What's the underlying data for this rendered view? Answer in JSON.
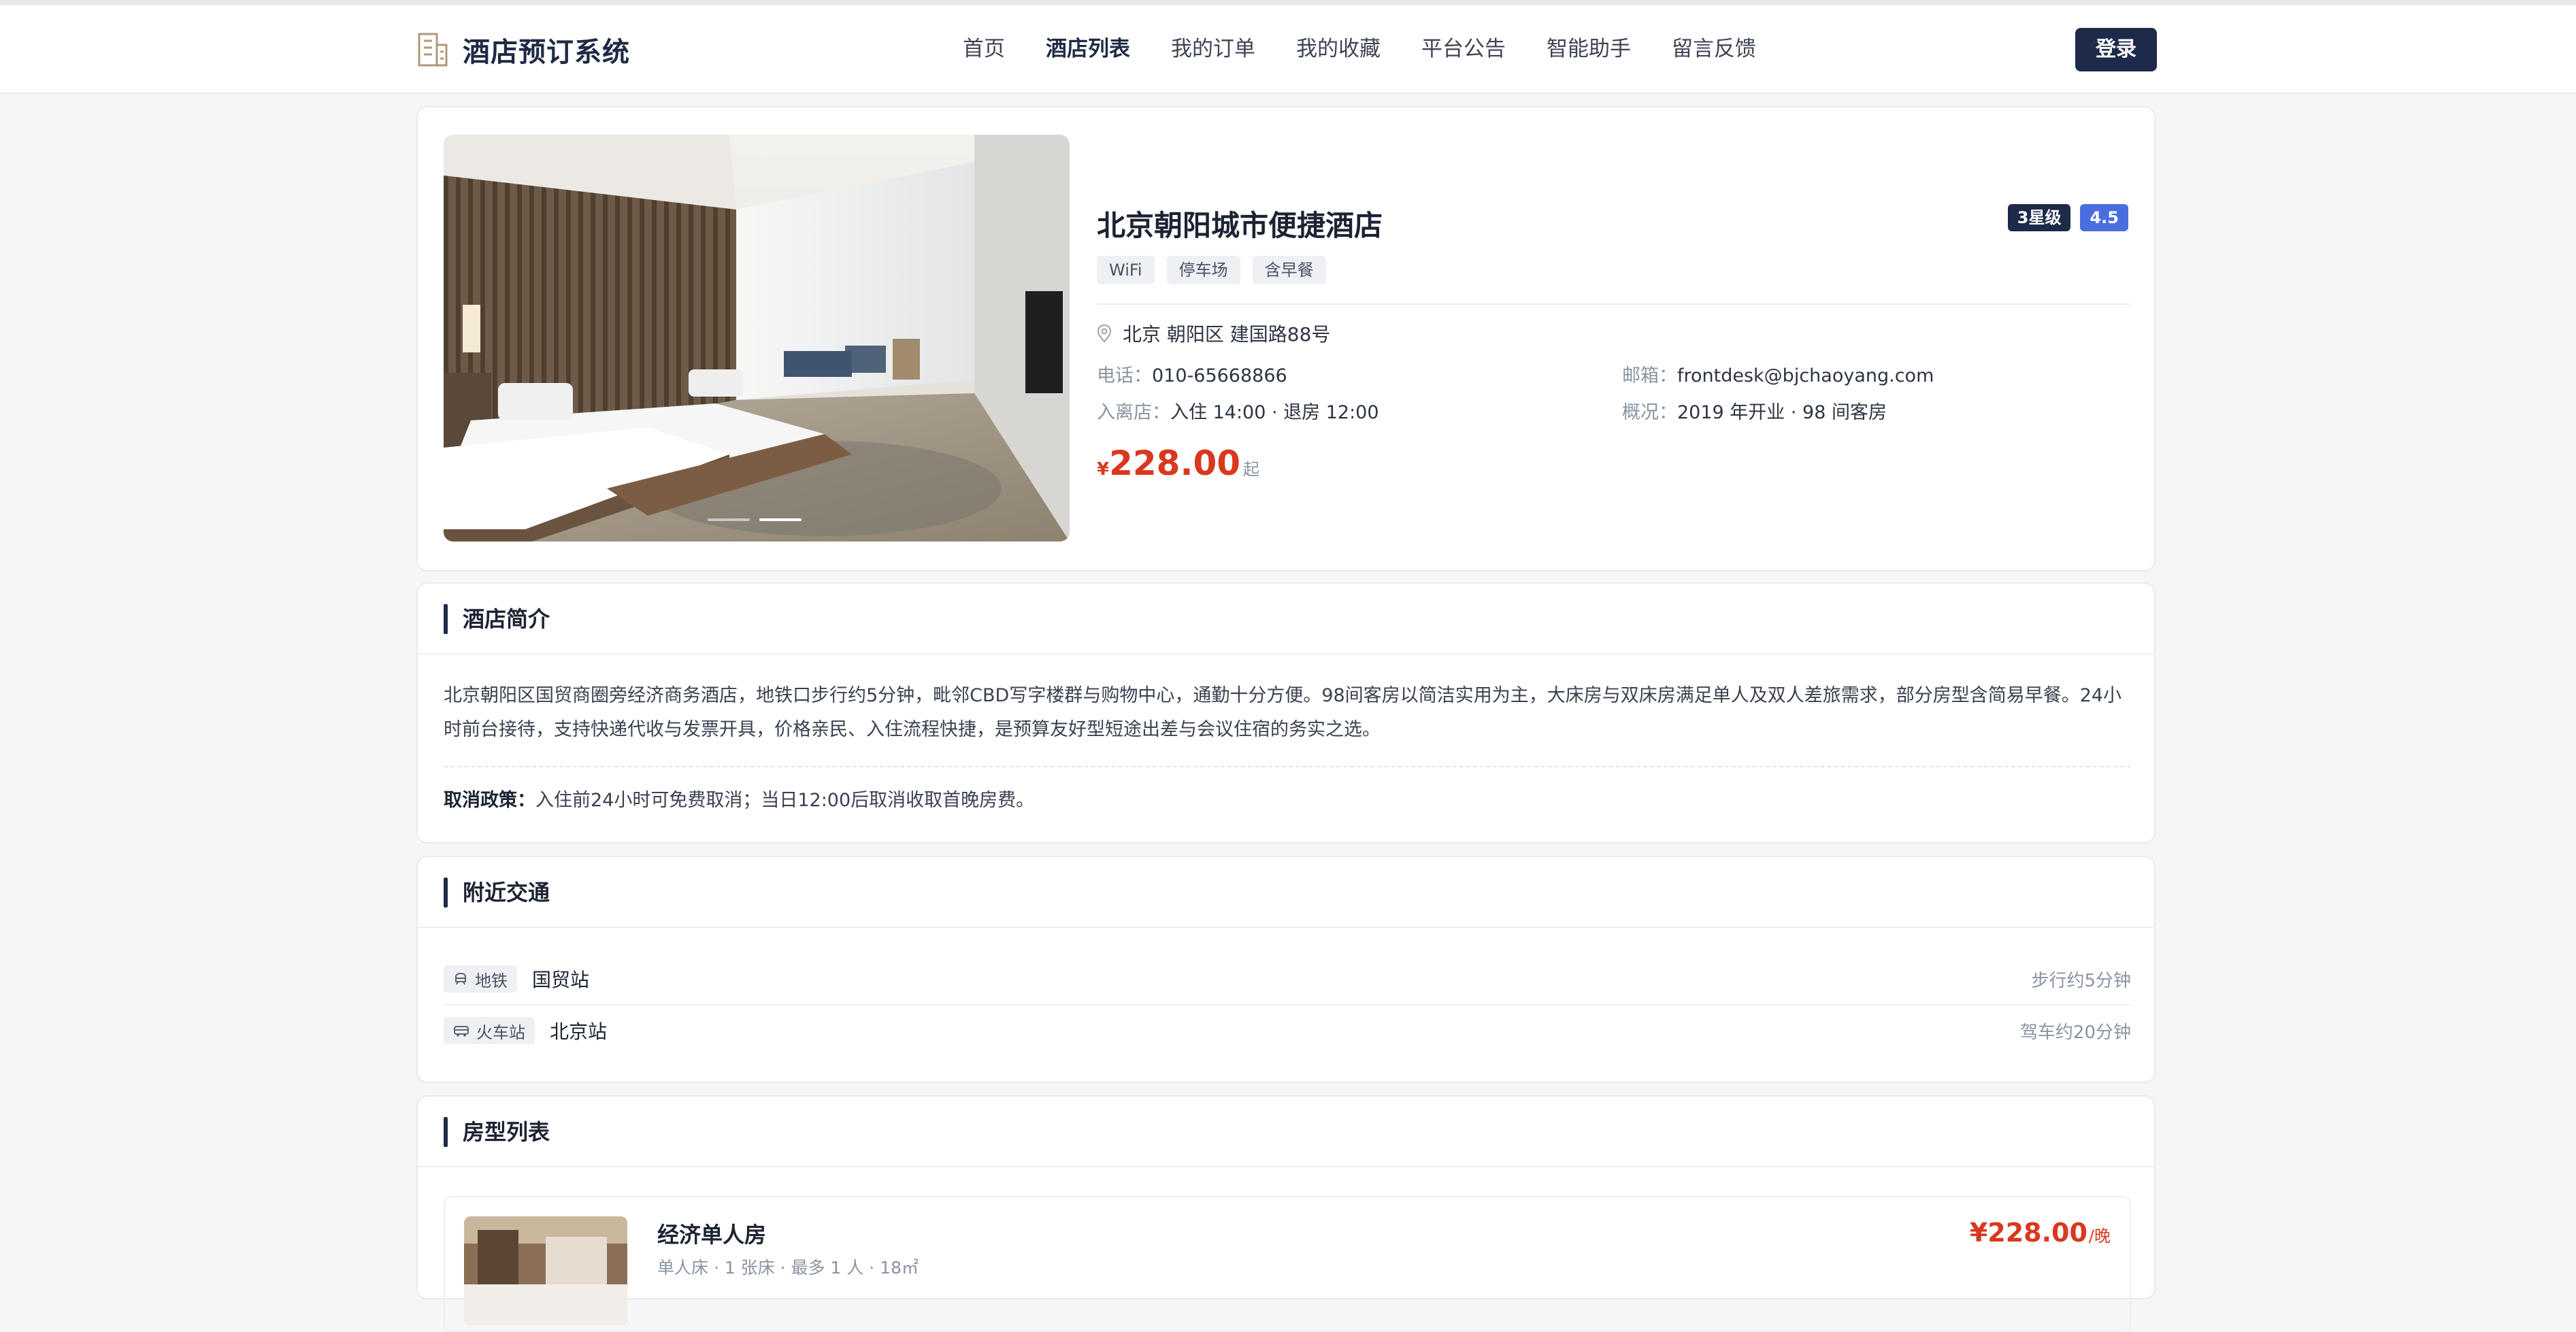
{
  "app": {
    "brand_title": "酒店预订系统",
    "brand_icon": "building-icon"
  },
  "nav": {
    "items": [
      {
        "label": "首页",
        "active": false
      },
      {
        "label": "酒店列表",
        "active": true
      },
      {
        "label": "我的订单",
        "active": false
      },
      {
        "label": "我的收藏",
        "active": false
      },
      {
        "label": "平台公告",
        "active": false
      },
      {
        "label": "智能助手",
        "active": false
      },
      {
        "label": "留言反馈",
        "active": false
      }
    ],
    "login_label": "登录"
  },
  "hotel": {
    "name": "北京朝阳城市便捷酒店",
    "star_badge": "3星级",
    "rating": "4.5",
    "tags": [
      "WiFi",
      "停车场",
      "含早餐"
    ],
    "address": "北京 朝阳区 建国路88号",
    "phone_label": "电话：",
    "phone": "010-65668866",
    "email_label": "邮箱：",
    "email": "frontdesk@bjchaoyang.com",
    "checkin_label": "入离店：",
    "checkin": "入住 14:00 · 退房 12:00",
    "overview_label": "概况：",
    "overview": "2019 年开业 · 98 间客房",
    "price_currency": "¥",
    "price": "228.00",
    "price_unit": "起",
    "carousel": {
      "count": 2,
      "active_index": 1
    }
  },
  "intro": {
    "title": "酒店简介",
    "text": "北京朝阳区国贸商圈旁经济商务酒店，地铁口步行约5分钟，毗邻CBD写字楼群与购物中心，通勤十分方便。98间客房以简洁实用为主，大床房与双床房满足单人及双人差旅需求，部分房型含简易早餐。24小时前台接待，支持快递代收与发票开具，价格亲民、入住流程快捷，是预算友好型短途出差与会议住宿的务实之选。",
    "policy_label": "取消政策：",
    "policy_text": "入住前24小时可免费取消；当日12:00后取消收取首晚房费。"
  },
  "traffic": {
    "title": "附近交通",
    "items": [
      {
        "type": "地铁",
        "icon": "subway-icon",
        "name": "国贸站",
        "distance": "步行约5分钟"
      },
      {
        "type": "火车站",
        "icon": "train-icon",
        "name": "北京站",
        "distance": "驾车约20分钟"
      }
    ]
  },
  "rooms": {
    "title": "房型列表",
    "items": [
      {
        "name": "经济单人房",
        "meta": "单人床 · 1 张床 · 最多 1 人 · 18㎡",
        "price": "¥228.00",
        "unit": "/晚"
      }
    ]
  },
  "colors": {
    "accent_navy": "#1e2a4a",
    "price_red": "#d9381e",
    "rating_blue": "#4a6ee0",
    "page_bg": "#f5f6f8"
  }
}
